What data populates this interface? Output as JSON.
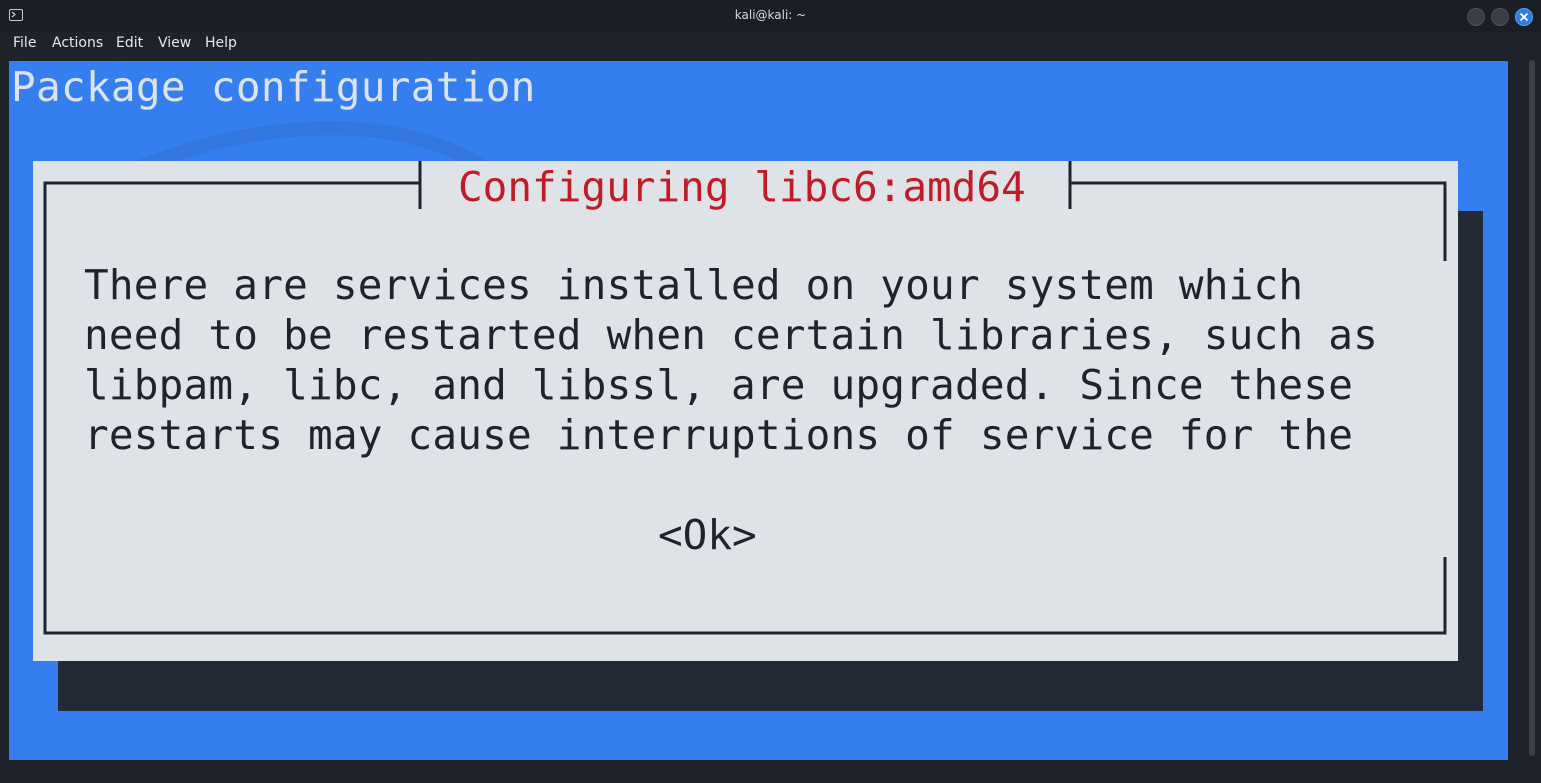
{
  "window": {
    "title": "kali@kali: ~"
  },
  "menu": {
    "file": "File",
    "actions": "Actions",
    "edit": "Edit",
    "view": "View",
    "help": "Help"
  },
  "terminal": {
    "header": "Package configuration",
    "dialog": {
      "title": "Configuring libc6:amd64",
      "lines": [
        "There are services installed on your system which",
        "need to be restarted when certain libraries, such as",
        "libpam, libc, and libssl, are upgraded. Since these",
        "restarts may cause interruptions of service for the"
      ],
      "ok_label": "<Ok>"
    }
  },
  "colors": {
    "terminal_bg": "#347ef0",
    "dialog_bg": "#dfe2e6",
    "dialog_title": "#c01c28",
    "dialog_shadow": "#232935",
    "chrome_bg": "#1f2229"
  }
}
